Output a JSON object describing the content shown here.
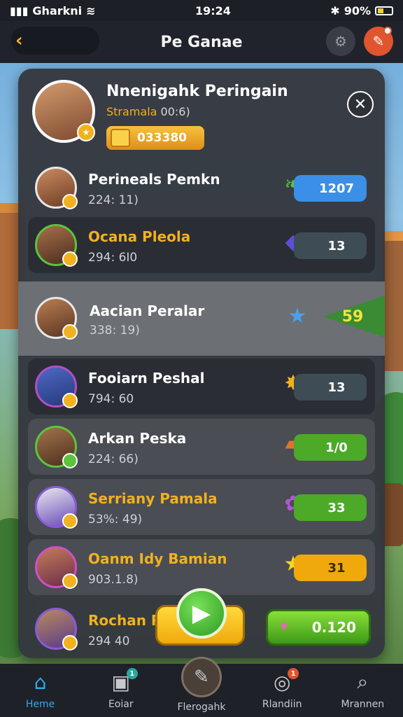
{
  "status_bar": {
    "carrier": "Gharkni",
    "time": "19:24",
    "battery": "90%"
  },
  "header": {
    "title": "Pe Ganae"
  },
  "profile": {
    "name": "Nnenigahk Peringain",
    "sub_accent": "Stramala",
    "sub_rest": "00:6)",
    "coins": "033380"
  },
  "rows": [
    {
      "name": "Perineals Pemkn",
      "score": "224: 11)",
      "reward": "1207",
      "reward_color": "#3b8fe6",
      "icon": "leaf-icon",
      "name_color": "#ffffff"
    },
    {
      "name": "Ocana Pleola",
      "score": "294: 6I0",
      "reward": "13",
      "reward_color": "#3d4c55",
      "icon": "gem-icon",
      "name_color": "#f2b11f"
    },
    {
      "name": "Aacian Peralar",
      "score": "338: 19)",
      "reward": "59",
      "reward_color": "#3a8b34",
      "icon": "star-icon",
      "name_color": "#ffffff"
    },
    {
      "name": "Fooiarn Peshal",
      "score": "794: 60",
      "reward": "13",
      "reward_color": "#3d4c55",
      "icon": "star-badge-icon",
      "name_color": "#ffffff"
    },
    {
      "name": "Arkan Peska",
      "score": "224: 66)",
      "reward": "1/0",
      "reward_color": "#4caa28",
      "icon": "chest-icon",
      "name_color": "#ffffff"
    },
    {
      "name": "Serriany Pamala",
      "score": "53%: 49)",
      "reward": "33",
      "reward_color": "#4caa28",
      "icon": "candy-icon",
      "name_color": "#f2b11f"
    },
    {
      "name": "Oanm Idy Bamian",
      "score": "903.1.8)",
      "reward": "31",
      "reward_color": "#f0a90d",
      "icon": "star-icon",
      "name_color": "#f2b11f"
    },
    {
      "name": "Rochan Pa",
      "score": "294 40",
      "reward": "0.120",
      "reward_color": "#4caa28",
      "icon": "gem-icon",
      "name_color": "#f2b11f"
    }
  ],
  "nav": [
    {
      "label": "Heme",
      "icon": "home-icon",
      "active": true
    },
    {
      "label": "Eoiar",
      "icon": "chat-icon",
      "badge": "1"
    },
    {
      "label": "Flerogahk",
      "icon": "brush-icon"
    },
    {
      "label": "Rlandiin",
      "icon": "target-icon",
      "badge": "1"
    },
    {
      "label": "Mrannen",
      "icon": "search-icon"
    }
  ],
  "colors": {
    "accent": "#f2b11f",
    "active_nav": "#36a7f0"
  }
}
